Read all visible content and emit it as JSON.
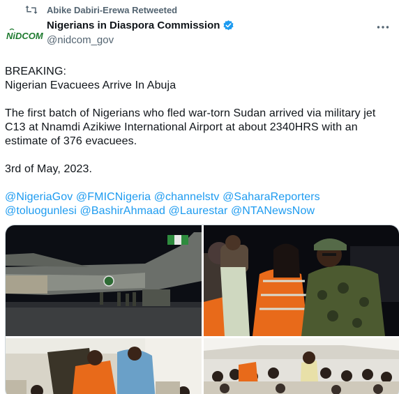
{
  "retweet": {
    "icon": "retweet-icon",
    "label": "Abike Dabiri-Erewa Retweeted"
  },
  "author": {
    "avatar_label": "NiDCOM",
    "name": "Nigerians in Diaspora Commission",
    "handle": "@nidcom_gov",
    "verified": true
  },
  "tweet": {
    "line1": "BREAKING:",
    "line2": "Nigerian Evacuees Arrive In Abuja",
    "body": "The first batch of Nigerians who fled war-torn Sudan arrived via military jet C13 at Nnamdi Azikiwe International Airport at about 2340HRS with an estimate of 376 evacuees.",
    "date": "3rd of May, 2023.",
    "mentions": [
      "@NigeriaGov",
      "@FMICNigeria",
      "@channelstv",
      "@SaharaReporters",
      "@toluogunlesi",
      "@BashirAhmaad",
      "@Laurestar",
      "@NTANewsNow"
    ]
  },
  "colors": {
    "link": "#1d9bf0",
    "secondary_text": "#536471",
    "verified": "#1d9bf0"
  }
}
